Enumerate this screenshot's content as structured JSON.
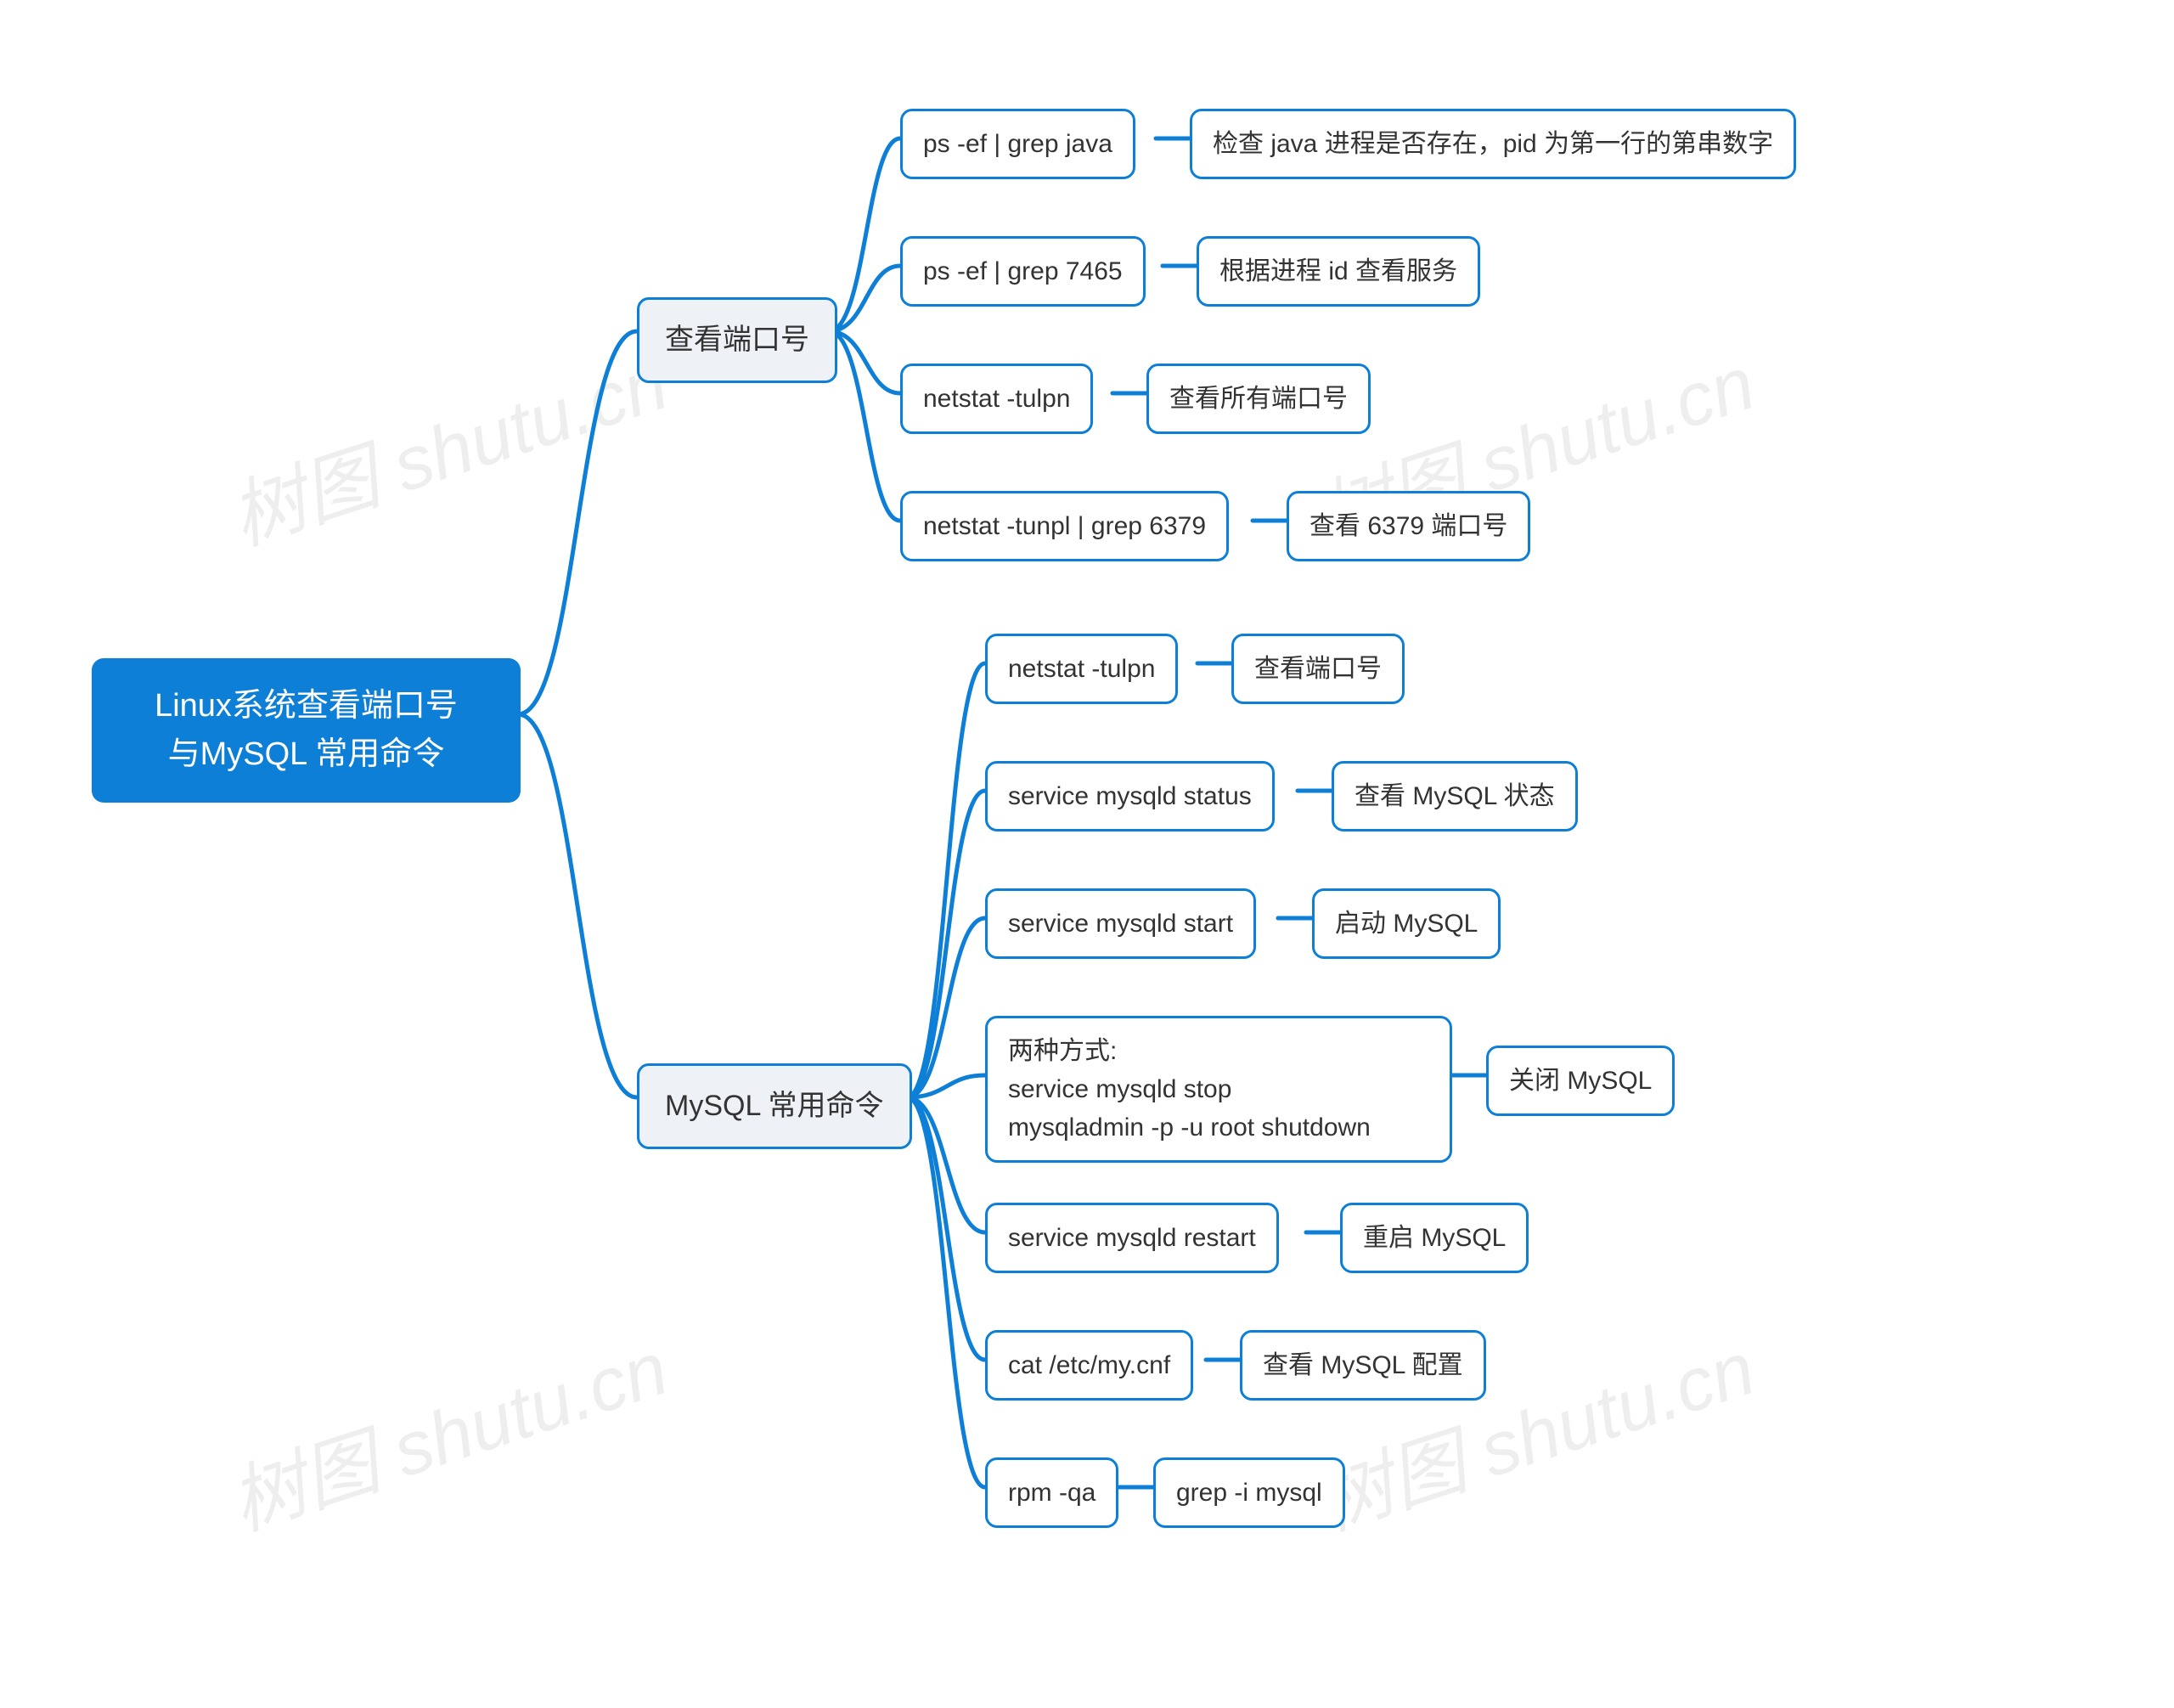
{
  "root": {
    "label": "Linux系统查看端口号\n与MySQL 常用命令"
  },
  "branches": {
    "ports": {
      "label": "查看端口号"
    },
    "mysql": {
      "label": "MySQL 常用命令"
    }
  },
  "ports_items": [
    {
      "cmd": "ps -ef | grep java",
      "desc": "检查 java 进程是否存在，pid 为第一行的第串数字"
    },
    {
      "cmd": "ps -ef | grep 7465",
      "desc": "根据进程 id 查看服务"
    },
    {
      "cmd": "netstat -tulpn",
      "desc": "查看所有端口号"
    },
    {
      "cmd": "netstat -tunpl | grep 6379",
      "desc": "查看 6379 端口号"
    }
  ],
  "mysql_items": [
    {
      "cmd": "netstat -tulpn",
      "desc": "查看端口号"
    },
    {
      "cmd": "service mysqld status",
      "desc": "查看 MySQL 状态"
    },
    {
      "cmd": "service mysqld start",
      "desc": "启动 MySQL"
    },
    {
      "cmd": "两种方式:\nservice mysqld stop\nmysqladmin -p -u root shutdown",
      "desc": "关闭 MySQL"
    },
    {
      "cmd": "service mysqld restart",
      "desc": "重启 MySQL"
    },
    {
      "cmd": "cat /etc/my.cnf",
      "desc": "查看 MySQL 配置"
    },
    {
      "cmd": "rpm -qa",
      "desc": "grep -i mysql"
    }
  ],
  "watermark_text": "树图 shutu.cn"
}
